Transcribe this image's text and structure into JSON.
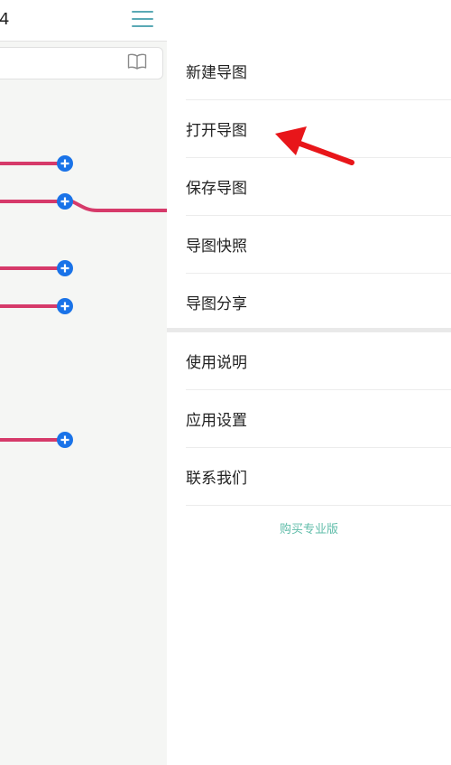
{
  "editor": {
    "title_fragment": "4",
    "menu_icon": "hamburger-menu-icon",
    "book_icon": "book-open-icon",
    "add_node_icon": "plus-circle-icon",
    "branch_color": "#d63a6a",
    "add_button_color": "#1a73e8"
  },
  "drawer": {
    "primary_items": [
      {
        "label": "新建导图"
      },
      {
        "label": "打开导图"
      },
      {
        "label": "保存导图"
      },
      {
        "label": "导图快照"
      },
      {
        "label": "导图分享"
      }
    ],
    "secondary_items": [
      {
        "label": "使用说明"
      },
      {
        "label": "应用设置"
      },
      {
        "label": "联系我们"
      }
    ],
    "buy_pro_label": "购买专业版",
    "accent_color": "#5fbca9"
  },
  "annotation": {
    "arrow_icon": "red-arrow-icon",
    "arrow_color": "#e8161a"
  }
}
